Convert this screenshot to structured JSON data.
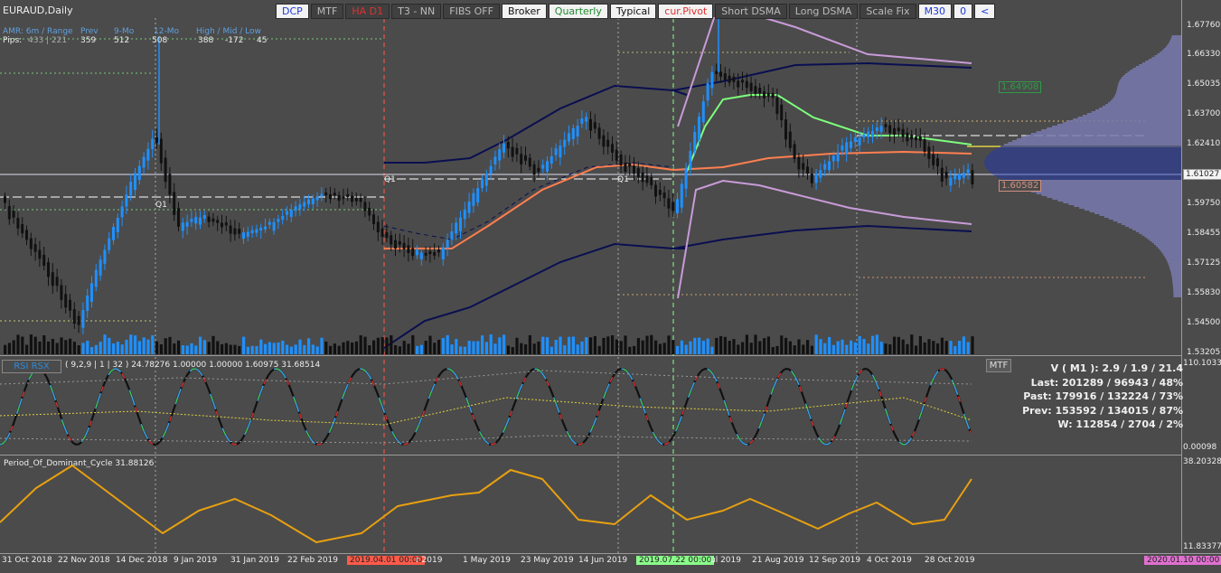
{
  "symbol_title": "EURAUD,Daily",
  "toolbar": [
    {
      "label": "DCP",
      "color": "#1e3ad8",
      "active": true
    },
    {
      "label": "MTF",
      "color": "#bbbbbb",
      "active": false
    },
    {
      "label": "HA D1",
      "color": "#e23030",
      "active": false
    },
    {
      "label": "T3 - NN",
      "color": "#bbbbbb",
      "active": false
    },
    {
      "label": "FIBS OFF",
      "color": "#bbbbbb",
      "active": false
    },
    {
      "label": "Broker",
      "color": "#111111",
      "active": true
    },
    {
      "label": "Quarterly",
      "color": "#1e8a30",
      "active": true
    },
    {
      "label": "Typical",
      "color": "#111111",
      "active": true
    },
    {
      "label": "cur.Pivot",
      "color": "#e23030",
      "active": true
    },
    {
      "label": "Short DSMA",
      "color": "#bbbbbb",
      "active": false
    },
    {
      "label": "Long DSMA",
      "color": "#bbbbbb",
      "active": false
    },
    {
      "label": "Scale Fix",
      "color": "#bbbbbb",
      "active": false
    },
    {
      "label": "M30",
      "color": "#1e3ad8",
      "active": true
    },
    {
      "label": "0",
      "color": "#1e3ad8",
      "active": true
    },
    {
      "label": "<",
      "color": "#1e3ad8",
      "active": true
    }
  ],
  "amr": {
    "labels": [
      "AMR: 6m / Range",
      "Prev",
      "9-Mo",
      "12-Mo",
      "High / Mid / Low"
    ],
    "values": [
      "Pips:",
      "433 | 221",
      "359",
      "512",
      "508",
      "388",
      "-172",
      "45"
    ]
  },
  "price_axis": [
    "1.67760",
    "1.66330",
    "1.65035",
    "1.63700",
    "1.62410",
    "1.61027",
    "1.59750",
    "1.58455",
    "1.57125",
    "1.55830",
    "1.54500",
    "1.53205"
  ],
  "current_price": "1.61027",
  "tags": {
    "upper": "1.64908",
    "lower": "1.60582"
  },
  "q_labels": [
    "Q1",
    "Q1",
    "Q1"
  ],
  "rsi": {
    "tag": "RSI RSX",
    "info": "( 9,2,9 | 1 | 32 ) 24.78276 1.00000 1.00000 1.60975 31.68514",
    "mtf": "MTF",
    "axis_top": "110.1033",
    "axis_bottom": "0.00098"
  },
  "stats": [
    "V ( M1 ): 2.9 / 1.9 / 21.4",
    "Last: 201289 / 96943 / 48%",
    "Past: 179916 / 132224 / 73%",
    "Prev: 153592 / 134015 / 87%",
    "W: 112854 / 2704 / 2%"
  ],
  "cycle": {
    "label": "Period_Of_Dominant_Cycle 31.88126",
    "axis_top": "38.20328",
    "axis_bottom": "11.83377"
  },
  "time_axis": [
    "31 Oct 2018",
    "22 Nov 2018",
    "14 Dec 2018",
    "9 Jan 2019",
    "31 Jan 2019",
    "22 Feb 2019",
    "2019.04.01 00:00",
    "r 2019",
    "1 May 2019",
    "23 May 2019",
    "14 Jun 2019",
    "2019.07.22 00:00",
    "ul 2019",
    "21 Aug 2019",
    "12 Sep 2019",
    "4 Oct 2019",
    "28 Oct 2019",
    "2020.01.10 00:00"
  ],
  "colors": {
    "bull": "#1e90ff",
    "bear": "#111111",
    "mid": "#ff7f50",
    "band": "#0a0f50",
    "envelope": "#c89bd8",
    "accent": "#7dff7d"
  }
}
